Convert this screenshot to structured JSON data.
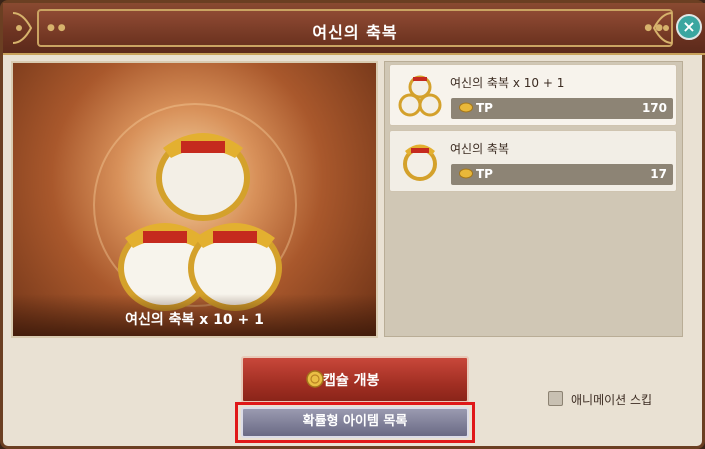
{
  "window": {
    "title": "여신의 축복"
  },
  "preview": {
    "name": "여신의 축복 x 10 + 1"
  },
  "list": {
    "items": [
      {
        "name": "여신의 축복 x 10 + 1",
        "currency": "TP",
        "price": "170",
        "selected": true
      },
      {
        "name": "여신의 축복",
        "currency": "TP",
        "price": "17",
        "selected": false
      }
    ]
  },
  "actions": {
    "open_label": "캡슐 개봉",
    "probability_label": "확률형 아이템 목록",
    "skip_label": "애니메이션 스킵",
    "skip_checked": false
  },
  "colors": {
    "header": "#6e3422",
    "open_button": "#a22f23",
    "highlight": "#e01818",
    "close_button": "#3aa6a0"
  },
  "icons": {
    "close": "close-icon",
    "currency": "coin-icon",
    "item": "blessing-capsule-icon"
  }
}
